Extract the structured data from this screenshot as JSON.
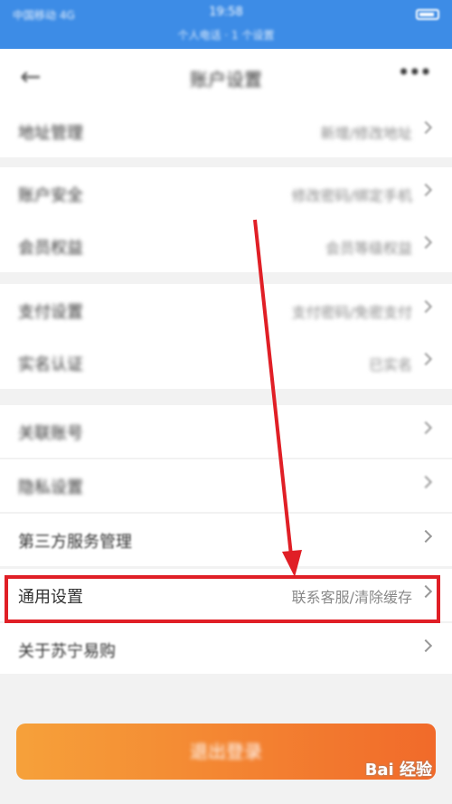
{
  "status_bar": {
    "carrier": "中国移动 4G",
    "time": "19:58",
    "subline": "个人电话 · 1 个设置"
  },
  "nav": {
    "back_icon": "arrow-left-icon",
    "title": "账户设置",
    "more_icon": "more-icon"
  },
  "settings": [
    {
      "label": "地址管理",
      "value": "新增/修改地址"
    },
    {
      "label": "账户安全",
      "value": "修改密码/绑定手机"
    },
    {
      "label": "会员权益",
      "value": "会员等级权益"
    },
    {
      "label": "支付设置",
      "value": "支付密码/免密支付"
    },
    {
      "label": "实名认证",
      "value": "已实名"
    },
    {
      "label": "关联账号",
      "value": ""
    },
    {
      "label": "隐私设置",
      "value": ""
    },
    {
      "label": "第三方服务管理",
      "value": ""
    },
    {
      "label": "通用设置",
      "value": "联系客服/清除缓存"
    },
    {
      "label": "关于苏宁易购",
      "value": ""
    }
  ],
  "logout_label": "退出登录",
  "annotation": {
    "color": "#e01f26"
  },
  "watermark": "Bai 经验",
  "colors": {
    "status_bar": "#3d8ce6",
    "logout_start": "#f6a13a",
    "logout_end": "#f16a2a"
  }
}
